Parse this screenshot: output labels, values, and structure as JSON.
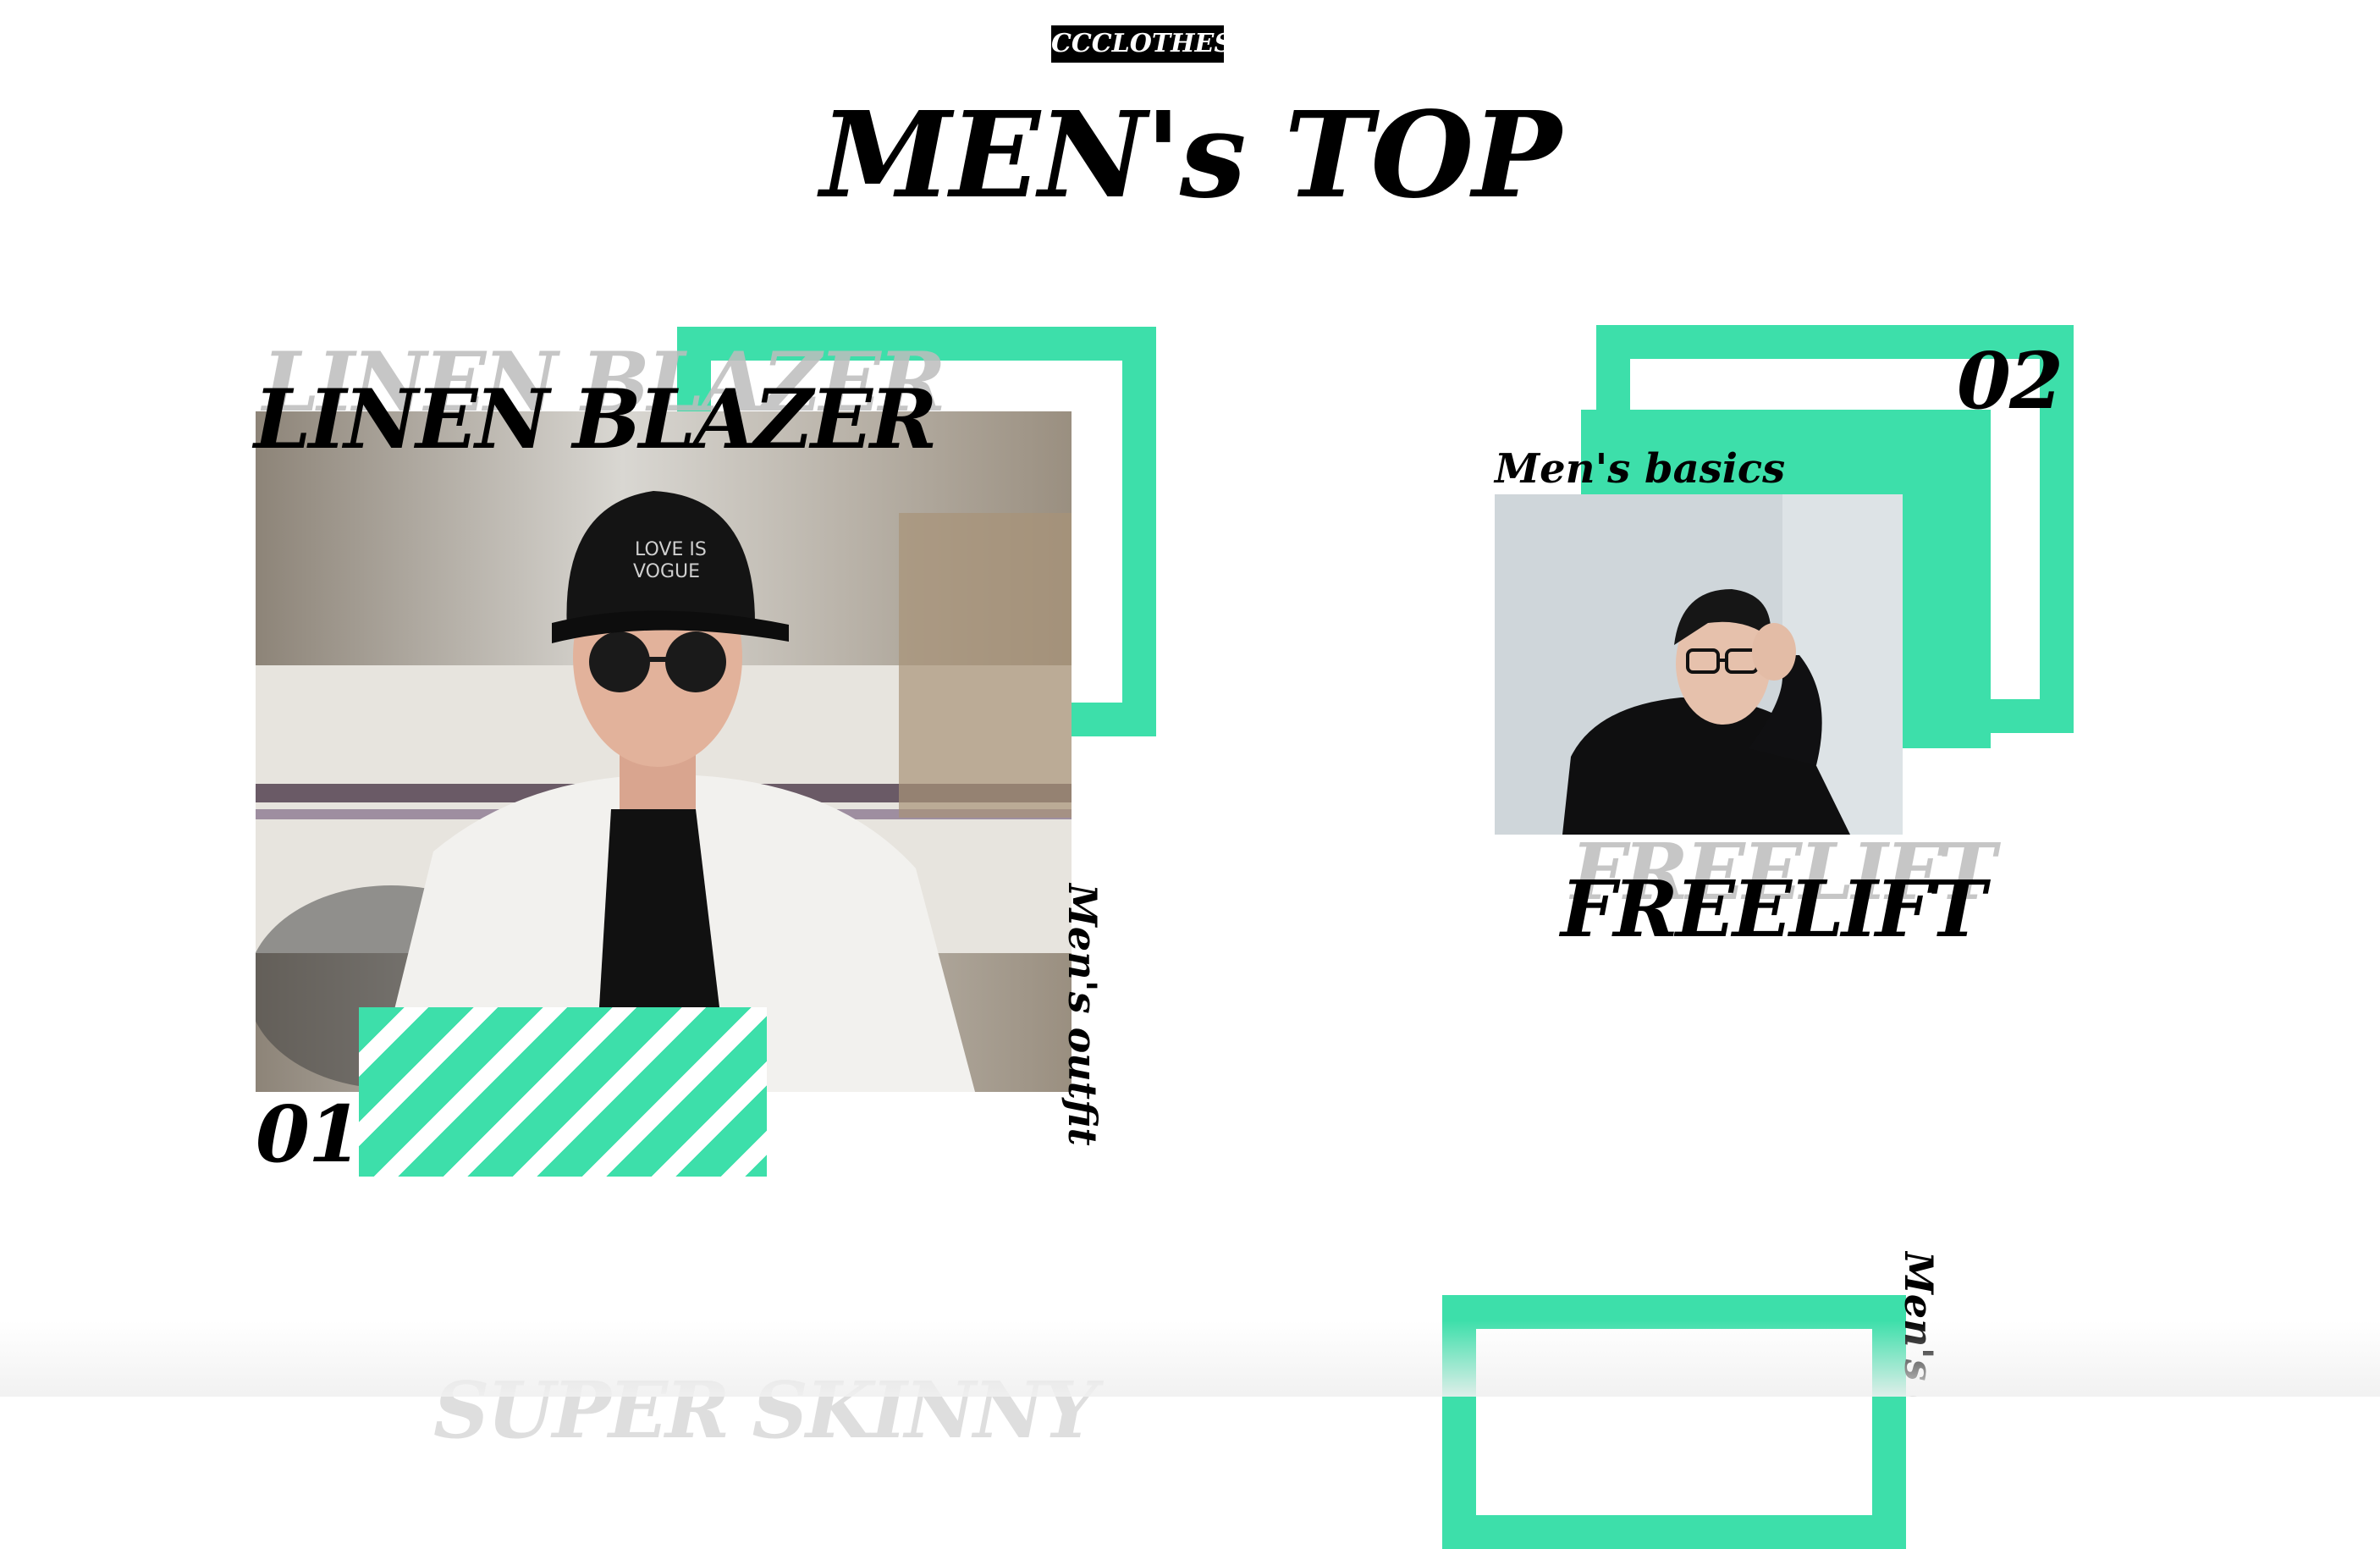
{
  "brand": {
    "name": "CCCLOTHES"
  },
  "page": {
    "title": "MEN's TOP"
  },
  "products": [
    {
      "name": "LINEN BLAZER",
      "number": "01",
      "caption": "Men's outfit",
      "accent_color": "#3ddfaa"
    },
    {
      "name": "FREELIFT",
      "number": "02",
      "caption": "Men's basics",
      "accent_color": "#3ddfaa"
    },
    {
      "name": "SUPER SKINNY",
      "caption": "Men's o"
    }
  ],
  "icons": [
    "portrait-photo",
    "portrait-photo"
  ]
}
